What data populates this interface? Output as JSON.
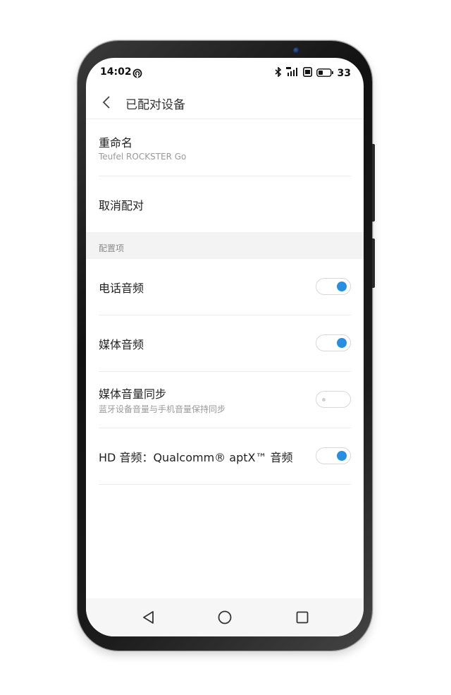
{
  "status_bar": {
    "time": "14:02",
    "battery_level": "33",
    "icons": [
      "hotspot-icon",
      "bluetooth-icon",
      "signal-4g-icon",
      "hd-icon",
      "battery-icon"
    ]
  },
  "header": {
    "title": "已配对设备",
    "back_icon": "chevron-left-icon"
  },
  "device": {
    "rename_label": "重命名",
    "device_name": "Teufel ROCKSTER Go",
    "unpair_label": "取消配对"
  },
  "config": {
    "section_label": "配置项",
    "items": [
      {
        "title": "电话音频",
        "subtitle": "",
        "enabled": true
      },
      {
        "title": "媒体音频",
        "subtitle": "",
        "enabled": true
      },
      {
        "title": "媒体音量同步",
        "subtitle": "蓝牙设备音量与手机音量保持同步",
        "enabled": false
      },
      {
        "title": "HD 音频：Qualcomm® aptX™ 音频",
        "subtitle": "",
        "enabled": true
      }
    ]
  },
  "nav_bar": {
    "icons": [
      "back-triangle-icon",
      "home-circle-icon",
      "recents-square-icon"
    ]
  },
  "colors": {
    "accent": "#2b8de0",
    "section_bg": "#f3f3f3",
    "navbar_bg": "#f6f6f6"
  }
}
